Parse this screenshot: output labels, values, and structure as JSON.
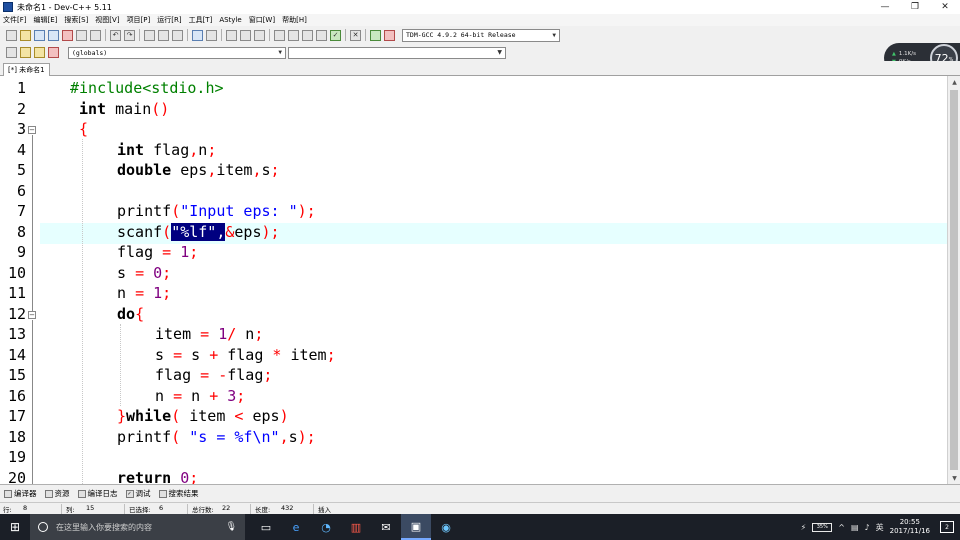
{
  "window": {
    "title": "未命名1 - Dev-C++ 5.11",
    "minimize": "—",
    "maximize": "❐",
    "close": "✕"
  },
  "menu": [
    "文件[F]",
    "编辑[E]",
    "搜索[S]",
    "视图[V]",
    "项目[P]",
    "运行[R]",
    "工具[T]",
    "AStyle",
    "窗口[W]",
    "帮助[H]"
  ],
  "toolbar": {
    "compiler": "TDM-GCC 4.9.2 64-bit Release",
    "scope": "(globals)"
  },
  "network_widget": {
    "upload": "1.1K/s",
    "download": "0K/s",
    "percent": "72",
    "percent_unit": "%"
  },
  "tab": {
    "label": "[*] 未命名1"
  },
  "editor": {
    "line_numbers": [
      "1",
      "2",
      "3",
      "4",
      "5",
      "6",
      "7",
      "8",
      "9",
      "10",
      "11",
      "12",
      "13",
      "14",
      "15",
      "16",
      "17",
      "18",
      "19",
      "20"
    ],
    "highlighted_line": 8,
    "code": [
      "#include<stdio.h>",
      "int main()",
      "{",
      "int flag,n;",
      "double eps,item,s;",
      "",
      "printf(\"Input eps: \");",
      "scanf(\"%lf\",&eps);",
      "flag = 1;",
      "s = 0;",
      "n = 1;",
      "do{",
      "item = 1/ n;",
      "s = s + flag * item;",
      "flag = -flag;",
      "n = n + 3;",
      "}while( item < eps)",
      "printf( \"s = %f\\n\",s);",
      "",
      "return 0;"
    ]
  },
  "bottom_tabs": [
    "编译器",
    "资源",
    "编译日志",
    "调试",
    "搜索结果"
  ],
  "status": {
    "row_label": "行:",
    "row": "8",
    "col_label": "列:",
    "col": "15",
    "sel_label": "已选择:",
    "sel": "6",
    "lines_label": "总行数:",
    "lines": "22",
    "len_label": "长度:",
    "len": "432",
    "mode": "插入"
  },
  "taskbar": {
    "search_placeholder": "在这里输入你要搜索的内容",
    "battery": "35%",
    "ime": "英",
    "time": "20:55",
    "date": "2017/11/16",
    "notifications": "2"
  }
}
